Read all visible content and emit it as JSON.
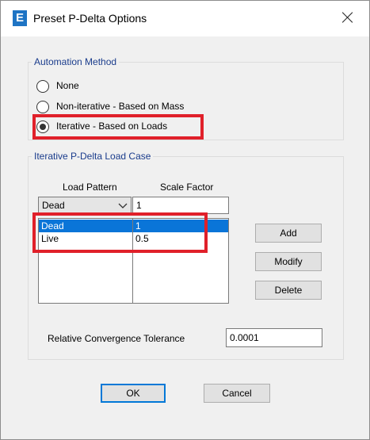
{
  "window": {
    "title": "Preset P-Delta Options",
    "app_icon": "E"
  },
  "automation": {
    "legend": "Automation Method",
    "options": [
      {
        "label": "None",
        "checked": false
      },
      {
        "label": "Non-iterative - Based on Mass",
        "checked": false
      },
      {
        "label": "Iterative - Based on Loads",
        "checked": true
      }
    ]
  },
  "load_case": {
    "legend": "Iterative P-Delta Load Case",
    "col_load_pattern": "Load Pattern",
    "col_scale_factor": "Scale Factor",
    "selected_pattern": "Dead",
    "scale_value": "1",
    "rows": [
      {
        "pattern": "Dead",
        "factor": "1",
        "selected": true
      },
      {
        "pattern": "Live",
        "factor": "0.5",
        "selected": false
      }
    ],
    "buttons": {
      "add": "Add",
      "modify": "Modify",
      "delete": "Delete"
    },
    "tolerance_label": "Relative Convergence Tolerance",
    "tolerance_value": "0.0001"
  },
  "footer": {
    "ok": "OK",
    "cancel": "Cancel"
  },
  "colors": {
    "accent": "#0078d7",
    "selection": "#0a75d8",
    "highlight": "#e0202a",
    "group_legend": "#1a3c8c"
  },
  "icons": {
    "app": "etabs-e-icon",
    "close": "close-icon",
    "dropdown": "chevron-down-icon"
  }
}
